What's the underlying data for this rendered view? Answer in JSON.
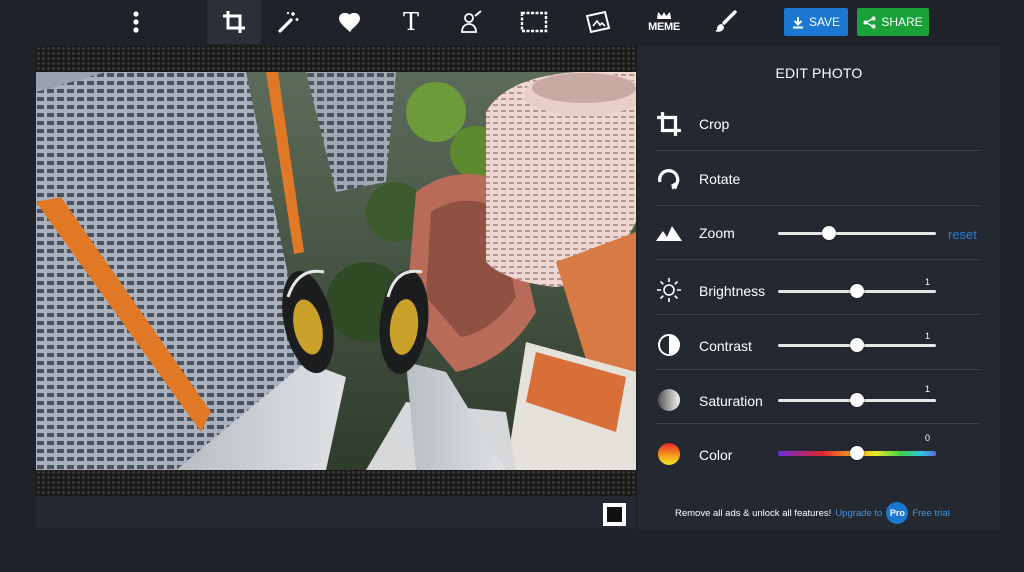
{
  "toolbar": {
    "tools": [
      {
        "name": "more-menu",
        "label": ""
      },
      {
        "name": "crop",
        "label": ""
      },
      {
        "name": "magic-wand",
        "label": ""
      },
      {
        "name": "heart",
        "label": ""
      },
      {
        "name": "text",
        "label": "T"
      },
      {
        "name": "draw",
        "label": ""
      },
      {
        "name": "frame",
        "label": ""
      },
      {
        "name": "sticker",
        "label": ""
      },
      {
        "name": "meme",
        "label": "MEME"
      },
      {
        "name": "brush",
        "label": ""
      }
    ],
    "active_tool": "crop",
    "save_label": "SAVE",
    "share_label": "SHARE"
  },
  "panel": {
    "title": "EDIT PHOTO",
    "items": [
      {
        "label": "Crop",
        "icon": "crop-icon"
      },
      {
        "label": "Rotate",
        "icon": "rotate-icon"
      },
      {
        "label": "Zoom",
        "icon": "mountains-icon",
        "slider_fraction": 0.32,
        "reset_label": "reset"
      },
      {
        "label": "Brightness",
        "icon": "sun-icon",
        "value": "1",
        "slider_fraction": 0.5
      },
      {
        "label": "Contrast",
        "icon": "contrast-icon",
        "value": "1",
        "slider_fraction": 0.5
      },
      {
        "label": "Saturation",
        "icon": "saturation-icon",
        "value": "1",
        "slider_fraction": 0.5
      },
      {
        "label": "Color",
        "icon": "color-gradient-icon",
        "value": "0",
        "slider_fraction": 0.5
      }
    ]
  },
  "promo": {
    "text": "Remove all ads & unlock all features!",
    "upgrade_label": "Upgrade to",
    "badge": "Pro",
    "trial_label": "Free trial"
  },
  "colors": {
    "background": "#1f2329",
    "panel": "#242830",
    "save": "#1b77d2",
    "share": "#19a23a",
    "link": "#2a7fd4"
  }
}
